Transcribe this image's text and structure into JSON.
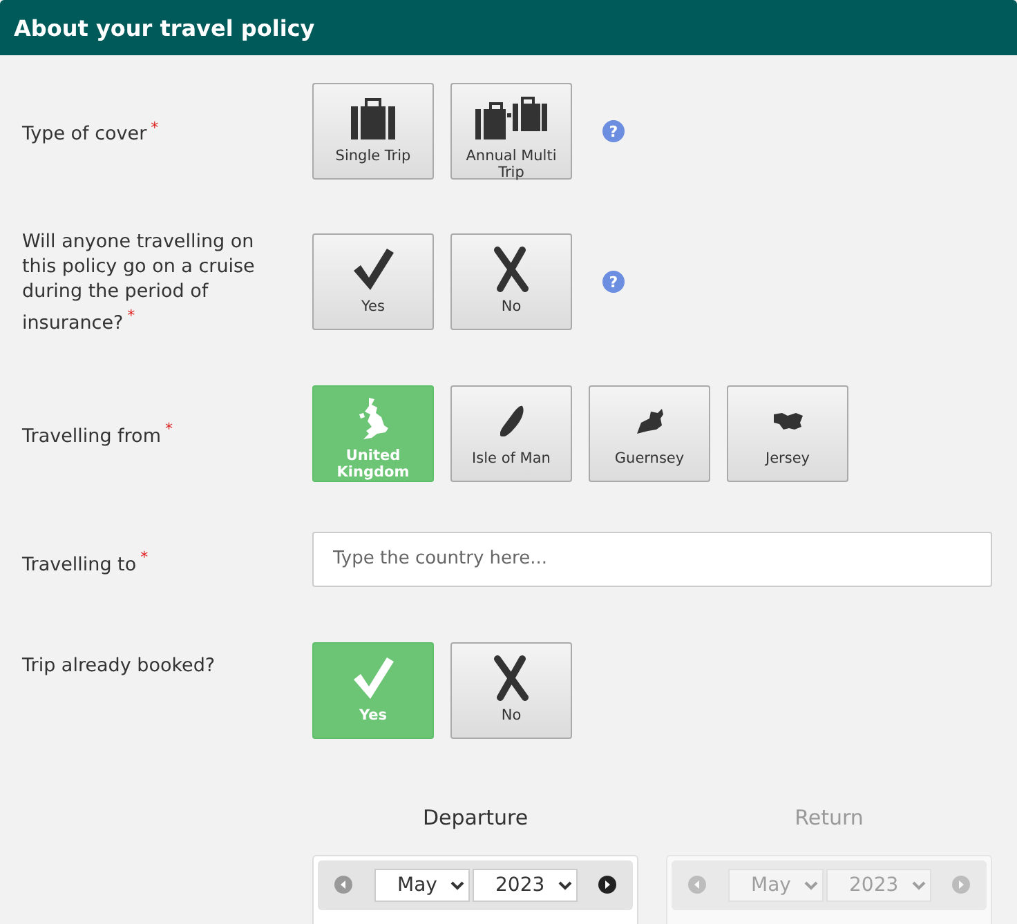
{
  "header": {
    "title": "About your travel policy"
  },
  "questions": [
    {
      "kind": "options",
      "label": "Type of cover",
      "required_mark": "*",
      "help": "?",
      "options": [
        {
          "label": "Single Trip",
          "kind": "suitcase",
          "selected": false
        },
        {
          "label": "Annual Multi Trip",
          "kind": "suitcases",
          "selected": false
        }
      ]
    },
    {
      "kind": "options",
      "label": "Will anyone travelling on this policy go on a cruise during the period of insurance?",
      "required_mark": "*",
      "help": "?",
      "options": [
        {
          "label": "Yes",
          "kind": "tick",
          "selected": false
        },
        {
          "label": "No",
          "kind": "cross",
          "selected": false
        }
      ]
    },
    {
      "kind": "options",
      "label": "Travelling from",
      "required_mark": "*",
      "options": [
        {
          "label": "United Kingdom",
          "kind": "uk",
          "selected": true
        },
        {
          "label": "Isle of Man",
          "kind": "man",
          "selected": false
        },
        {
          "label": "Guernsey",
          "kind": "guernsey",
          "selected": false
        },
        {
          "label": "Jersey",
          "kind": "jersey",
          "selected": false
        }
      ]
    },
    {
      "kind": "text",
      "label": "Travelling to",
      "required_mark": "*",
      "placeholder": "Type the country here..."
    },
    {
      "kind": "options",
      "label": "Trip already booked?",
      "options": [
        {
          "label": "Yes",
          "kind": "tick",
          "selected": true
        },
        {
          "label": "No",
          "kind": "cross",
          "selected": false
        }
      ]
    }
  ],
  "calendars": [
    {
      "title": "Departure",
      "disabled": false,
      "month": "May",
      "year": "2023",
      "prev_disabled": true,
      "next_disabled": false
    },
    {
      "title": "Return",
      "disabled": true,
      "month": "May",
      "year": "2023",
      "prev_disabled": true,
      "next_disabled": true
    }
  ]
}
